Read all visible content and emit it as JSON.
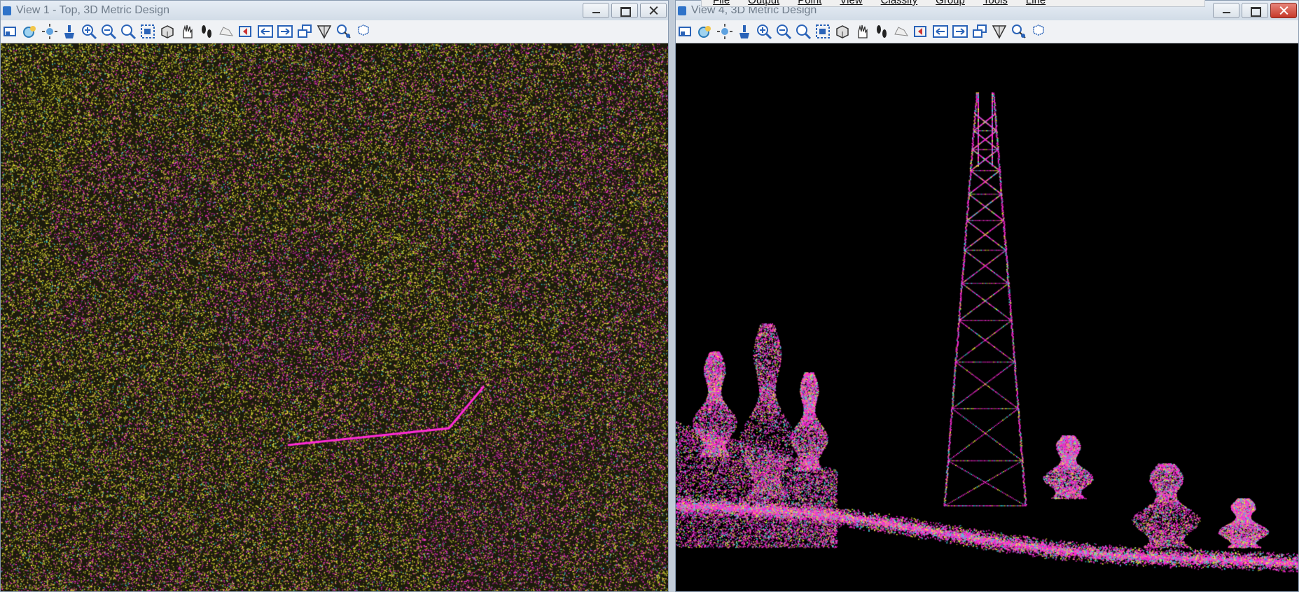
{
  "left_window": {
    "title": "View 1 - Top, 3D Metric Design"
  },
  "right_window": {
    "title": "View 4, 3D Metric Design"
  },
  "menubar": {
    "items": [
      "File",
      "Output",
      "Point",
      "View",
      "Classify",
      "Group",
      "Tools",
      "Line"
    ]
  },
  "toolbar": {
    "icons": [
      "view-attributes-icon",
      "display-style-icon",
      "lighting-icon",
      "update-view-icon",
      "zoom-in-icon",
      "zoom-out-icon",
      "fit-view-icon",
      "window-area-icon",
      "rotate-view-icon",
      "pan-view-icon",
      "walk-icon",
      "previous-view-icon",
      "next-view-icon",
      "view-previous-icon",
      "view-next-icon",
      "copy-view-icon",
      "clip-volume-icon",
      "clip-mask-icon",
      "toggle-camera-icon"
    ]
  },
  "colors": {
    "magenta": "#ff2bd6",
    "yellow": "#f3ef3a",
    "cyan": "#3ed9e6",
    "viewport_bg": "#000000"
  }
}
